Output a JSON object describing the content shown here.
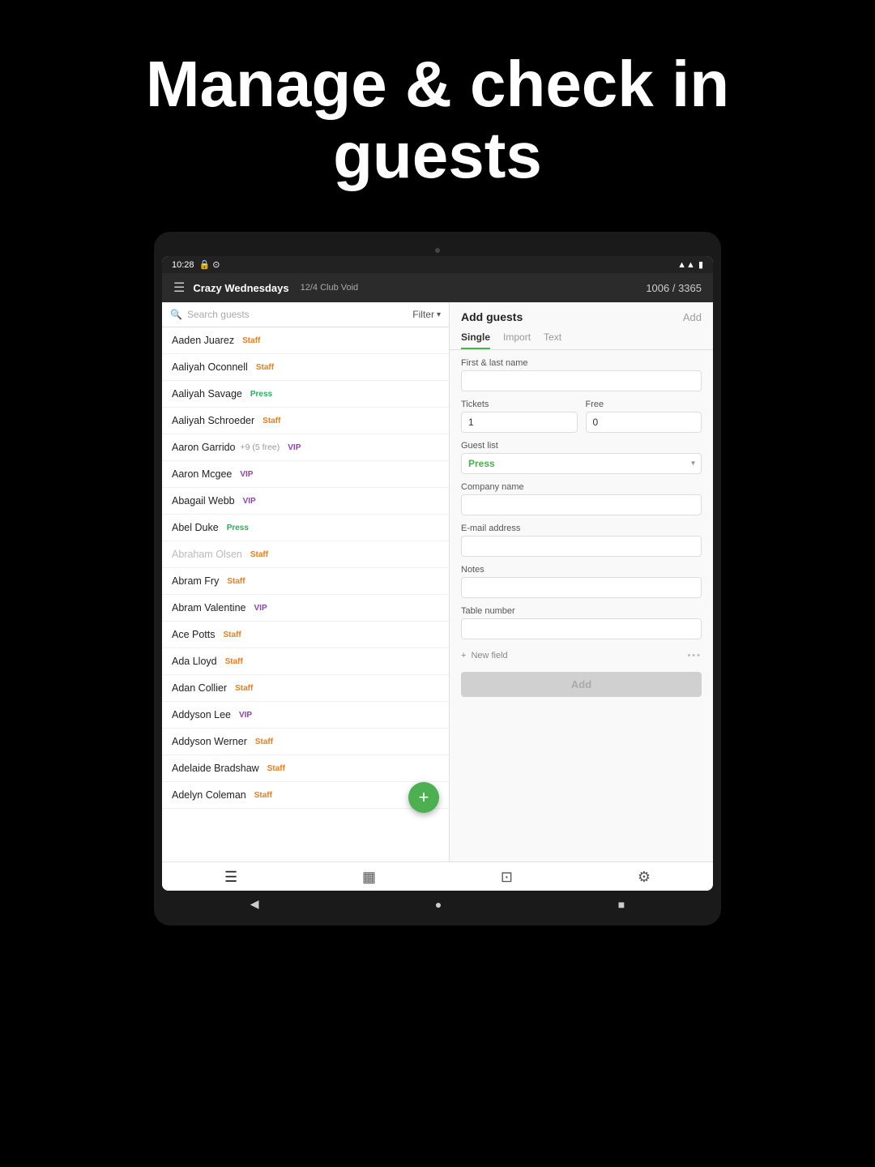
{
  "hero": {
    "title": "Manage & check in guests"
  },
  "status_bar": {
    "time": "10:28",
    "wifi": "▲",
    "signal": "▲",
    "battery": "▮"
  },
  "app_header": {
    "title": "Crazy Wednesdays",
    "subtitle": "12/4  Club Void",
    "count": "1006 / 3365"
  },
  "search": {
    "placeholder": "Search guests",
    "filter_label": "Filter"
  },
  "guests": [
    {
      "name": "Aaden Juarez",
      "tag": "Staff",
      "tag_type": "staff",
      "extra": ""
    },
    {
      "name": "Aaliyah Oconnell",
      "tag": "Staff",
      "tag_type": "staff",
      "extra": ""
    },
    {
      "name": "Aaliyah Savage",
      "tag": "Press",
      "tag_type": "press",
      "extra": ""
    },
    {
      "name": "Aaliyah Schroeder",
      "tag": "Staff",
      "tag_type": "staff",
      "extra": ""
    },
    {
      "name": "Aaron Garrido",
      "tag": "VIP",
      "tag_type": "vip",
      "extra": "+9 (5 free)"
    },
    {
      "name": "Aaron Mcgee",
      "tag": "VIP",
      "tag_type": "vip",
      "extra": ""
    },
    {
      "name": "Abagail Webb",
      "tag": "VIP",
      "tag_type": "vip",
      "extra": ""
    },
    {
      "name": "Abel Duke",
      "tag": "Press",
      "tag_type": "press",
      "extra": ""
    },
    {
      "name": "Abraham Olsen",
      "tag": "Staff",
      "tag_type": "staff",
      "extra": "",
      "dimmed": true
    },
    {
      "name": "Abram Fry",
      "tag": "Staff",
      "tag_type": "staff",
      "extra": ""
    },
    {
      "name": "Abram Valentine",
      "tag": "VIP",
      "tag_type": "vip",
      "extra": ""
    },
    {
      "name": "Ace Potts",
      "tag": "Staff",
      "tag_type": "staff",
      "extra": ""
    },
    {
      "name": "Ada Lloyd",
      "tag": "Staff",
      "tag_type": "staff",
      "extra": ""
    },
    {
      "name": "Adan Collier",
      "tag": "Staff",
      "tag_type": "staff",
      "extra": ""
    },
    {
      "name": "Addyson Lee",
      "tag": "VIP",
      "tag_type": "vip",
      "extra": ""
    },
    {
      "name": "Addyson Werner",
      "tag": "Staff",
      "tag_type": "staff",
      "extra": ""
    },
    {
      "name": "Adelaide Bradshaw",
      "tag": "Staff",
      "tag_type": "staff",
      "extra": ""
    },
    {
      "name": "Adelyn Coleman",
      "tag": "Staff",
      "tag_type": "staff",
      "extra": ""
    }
  ],
  "add_guests_panel": {
    "title": "Add guests",
    "add_label": "Add",
    "tabs": [
      "Single",
      "Import",
      "Text"
    ],
    "active_tab": "Single",
    "form": {
      "first_last_name_label": "First & last name",
      "first_last_name_value": "",
      "tickets_label": "Tickets",
      "tickets_value": "1",
      "free_label": "Free",
      "free_value": "0",
      "guest_list_label": "Guest list",
      "guest_list_value": "Press",
      "company_name_label": "Company name",
      "company_name_value": "",
      "email_label": "E-mail address",
      "email_value": "",
      "notes_label": "Notes",
      "notes_value": "",
      "table_number_label": "Table number",
      "table_number_value": "",
      "new_field_label": "New field",
      "add_btn_label": "Add"
    }
  },
  "bottom_nav": {
    "items": [
      {
        "icon": "≡",
        "name": "list-icon",
        "active": true
      },
      {
        "icon": "▦",
        "name": "stats-icon",
        "active": false
      },
      {
        "icon": "⊡",
        "name": "scan-icon",
        "active": false
      },
      {
        "icon": "⚙",
        "name": "settings-icon",
        "active": false
      }
    ]
  },
  "android_nav": {
    "back": "◀",
    "home": "●",
    "recent": "■"
  },
  "fab": {
    "icon": "+"
  }
}
